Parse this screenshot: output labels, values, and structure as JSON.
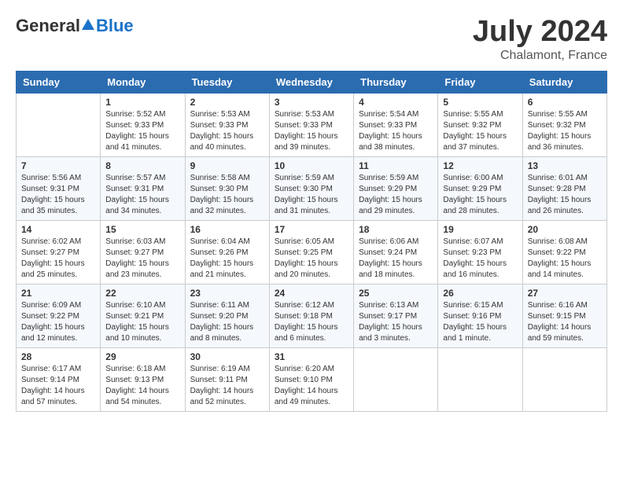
{
  "header": {
    "logo_general": "General",
    "logo_blue": "Blue",
    "month": "July 2024",
    "location": "Chalamont, France"
  },
  "days_of_week": [
    "Sunday",
    "Monday",
    "Tuesday",
    "Wednesday",
    "Thursday",
    "Friday",
    "Saturday"
  ],
  "weeks": [
    [
      {
        "day": "",
        "sunrise": "",
        "sunset": "",
        "daylight": ""
      },
      {
        "day": "1",
        "sunrise": "Sunrise: 5:52 AM",
        "sunset": "Sunset: 9:33 PM",
        "daylight": "Daylight: 15 hours and 41 minutes."
      },
      {
        "day": "2",
        "sunrise": "Sunrise: 5:53 AM",
        "sunset": "Sunset: 9:33 PM",
        "daylight": "Daylight: 15 hours and 40 minutes."
      },
      {
        "day": "3",
        "sunrise": "Sunrise: 5:53 AM",
        "sunset": "Sunset: 9:33 PM",
        "daylight": "Daylight: 15 hours and 39 minutes."
      },
      {
        "day": "4",
        "sunrise": "Sunrise: 5:54 AM",
        "sunset": "Sunset: 9:33 PM",
        "daylight": "Daylight: 15 hours and 38 minutes."
      },
      {
        "day": "5",
        "sunrise": "Sunrise: 5:55 AM",
        "sunset": "Sunset: 9:32 PM",
        "daylight": "Daylight: 15 hours and 37 minutes."
      },
      {
        "day": "6",
        "sunrise": "Sunrise: 5:55 AM",
        "sunset": "Sunset: 9:32 PM",
        "daylight": "Daylight: 15 hours and 36 minutes."
      }
    ],
    [
      {
        "day": "7",
        "sunrise": "Sunrise: 5:56 AM",
        "sunset": "Sunset: 9:31 PM",
        "daylight": "Daylight: 15 hours and 35 minutes."
      },
      {
        "day": "8",
        "sunrise": "Sunrise: 5:57 AM",
        "sunset": "Sunset: 9:31 PM",
        "daylight": "Daylight: 15 hours and 34 minutes."
      },
      {
        "day": "9",
        "sunrise": "Sunrise: 5:58 AM",
        "sunset": "Sunset: 9:30 PM",
        "daylight": "Daylight: 15 hours and 32 minutes."
      },
      {
        "day": "10",
        "sunrise": "Sunrise: 5:59 AM",
        "sunset": "Sunset: 9:30 PM",
        "daylight": "Daylight: 15 hours and 31 minutes."
      },
      {
        "day": "11",
        "sunrise": "Sunrise: 5:59 AM",
        "sunset": "Sunset: 9:29 PM",
        "daylight": "Daylight: 15 hours and 29 minutes."
      },
      {
        "day": "12",
        "sunrise": "Sunrise: 6:00 AM",
        "sunset": "Sunset: 9:29 PM",
        "daylight": "Daylight: 15 hours and 28 minutes."
      },
      {
        "day": "13",
        "sunrise": "Sunrise: 6:01 AM",
        "sunset": "Sunset: 9:28 PM",
        "daylight": "Daylight: 15 hours and 26 minutes."
      }
    ],
    [
      {
        "day": "14",
        "sunrise": "Sunrise: 6:02 AM",
        "sunset": "Sunset: 9:27 PM",
        "daylight": "Daylight: 15 hours and 25 minutes."
      },
      {
        "day": "15",
        "sunrise": "Sunrise: 6:03 AM",
        "sunset": "Sunset: 9:27 PM",
        "daylight": "Daylight: 15 hours and 23 minutes."
      },
      {
        "day": "16",
        "sunrise": "Sunrise: 6:04 AM",
        "sunset": "Sunset: 9:26 PM",
        "daylight": "Daylight: 15 hours and 21 minutes."
      },
      {
        "day": "17",
        "sunrise": "Sunrise: 6:05 AM",
        "sunset": "Sunset: 9:25 PM",
        "daylight": "Daylight: 15 hours and 20 minutes."
      },
      {
        "day": "18",
        "sunrise": "Sunrise: 6:06 AM",
        "sunset": "Sunset: 9:24 PM",
        "daylight": "Daylight: 15 hours and 18 minutes."
      },
      {
        "day": "19",
        "sunrise": "Sunrise: 6:07 AM",
        "sunset": "Sunset: 9:23 PM",
        "daylight": "Daylight: 15 hours and 16 minutes."
      },
      {
        "day": "20",
        "sunrise": "Sunrise: 6:08 AM",
        "sunset": "Sunset: 9:22 PM",
        "daylight": "Daylight: 15 hours and 14 minutes."
      }
    ],
    [
      {
        "day": "21",
        "sunrise": "Sunrise: 6:09 AM",
        "sunset": "Sunset: 9:22 PM",
        "daylight": "Daylight: 15 hours and 12 minutes."
      },
      {
        "day": "22",
        "sunrise": "Sunrise: 6:10 AM",
        "sunset": "Sunset: 9:21 PM",
        "daylight": "Daylight: 15 hours and 10 minutes."
      },
      {
        "day": "23",
        "sunrise": "Sunrise: 6:11 AM",
        "sunset": "Sunset: 9:20 PM",
        "daylight": "Daylight: 15 hours and 8 minutes."
      },
      {
        "day": "24",
        "sunrise": "Sunrise: 6:12 AM",
        "sunset": "Sunset: 9:18 PM",
        "daylight": "Daylight: 15 hours and 6 minutes."
      },
      {
        "day": "25",
        "sunrise": "Sunrise: 6:13 AM",
        "sunset": "Sunset: 9:17 PM",
        "daylight": "Daylight: 15 hours and 3 minutes."
      },
      {
        "day": "26",
        "sunrise": "Sunrise: 6:15 AM",
        "sunset": "Sunset: 9:16 PM",
        "daylight": "Daylight: 15 hours and 1 minute."
      },
      {
        "day": "27",
        "sunrise": "Sunrise: 6:16 AM",
        "sunset": "Sunset: 9:15 PM",
        "daylight": "Daylight: 14 hours and 59 minutes."
      }
    ],
    [
      {
        "day": "28",
        "sunrise": "Sunrise: 6:17 AM",
        "sunset": "Sunset: 9:14 PM",
        "daylight": "Daylight: 14 hours and 57 minutes."
      },
      {
        "day": "29",
        "sunrise": "Sunrise: 6:18 AM",
        "sunset": "Sunset: 9:13 PM",
        "daylight": "Daylight: 14 hours and 54 minutes."
      },
      {
        "day": "30",
        "sunrise": "Sunrise: 6:19 AM",
        "sunset": "Sunset: 9:11 PM",
        "daylight": "Daylight: 14 hours and 52 minutes."
      },
      {
        "day": "31",
        "sunrise": "Sunrise: 6:20 AM",
        "sunset": "Sunset: 9:10 PM",
        "daylight": "Daylight: 14 hours and 49 minutes."
      },
      {
        "day": "",
        "sunrise": "",
        "sunset": "",
        "daylight": ""
      },
      {
        "day": "",
        "sunrise": "",
        "sunset": "",
        "daylight": ""
      },
      {
        "day": "",
        "sunrise": "",
        "sunset": "",
        "daylight": ""
      }
    ]
  ]
}
